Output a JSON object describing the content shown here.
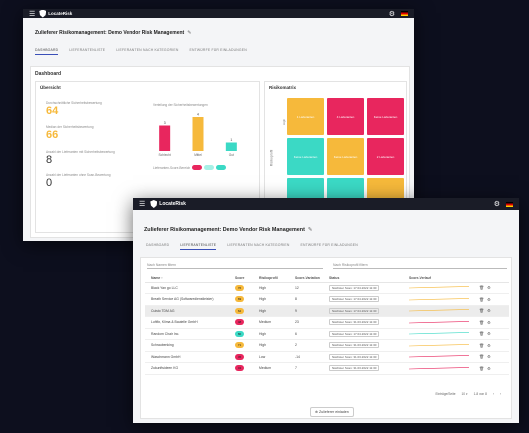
{
  "app": {
    "name": "LocateRisk",
    "title": "Zulieferer Risikomanagement: Demo Vendor Risk Management"
  },
  "tabs": [
    {
      "label": "DASHBOARD"
    },
    {
      "label": "LIEFERANTENLISTE"
    },
    {
      "label": "LIEFERANTEN NACH KATEGORIEN"
    },
    {
      "label": "ENTWÜRFE FÜR EINLADUNGEN"
    }
  ],
  "dashboard": {
    "heading": "Dashboard",
    "overview": {
      "heading": "Übersicht",
      "kpis": [
        {
          "label": "Durchschnittliche Sicherheitsbewertung",
          "value": "64",
          "color": "#f6b93b"
        },
        {
          "label": "Median der Sicherheitsbewertung",
          "value": "66",
          "color": "#f6b93b"
        },
        {
          "label": "Anzahl der Lieferanten mit Sicherheitsbewertung",
          "value": "8",
          "color": "#333333"
        },
        {
          "label": "Anzahl der Lieferanten ohne Scan-Bewertung",
          "value": "0",
          "color": "#333333"
        }
      ],
      "distribution_title": "Verteilung der Sicherheitsbewertungen",
      "legend_label": "Lieferanten-Score-Bereich"
    },
    "matrix": {
      "heading": "Risikomatrix",
      "y_axis": "Risikoprofil",
      "y_tick": "High",
      "cells": [
        {
          "label": "1 Lieferanten",
          "color": "#f6b93b"
        },
        {
          "label": "4 Lieferanten",
          "color": "#e8265e"
        },
        {
          "label": "Keine Lieferanten",
          "color": "#e8265e"
        },
        {
          "label": "Keine Lieferanten",
          "color": "#3bd9c5"
        },
        {
          "label": "Keine Lieferanten",
          "color": "#f6b93b"
        },
        {
          "label": "2 Lieferanten",
          "color": "#e8265e"
        },
        {
          "label": "",
          "color": "#3bd9c5"
        },
        {
          "label": "",
          "color": "#3bd9c5"
        },
        {
          "label": "",
          "color": "#f6b93b"
        }
      ]
    }
  },
  "chart_data": {
    "type": "bar",
    "title": "Verteilung der Sicherheitsbewertungen",
    "categories": [
      "Schlecht",
      "Mittel",
      "Gut"
    ],
    "values": [
      3,
      4,
      1
    ],
    "data_labels": [
      "3",
      "4",
      "1"
    ],
    "colors": [
      "#e8265e",
      "#f6b93b",
      "#3bd9c5"
    ],
    "ylim": [
      0,
      4
    ]
  },
  "list": {
    "filter_name": "Nach Namen filtern",
    "filter_profile": "Nach Risikoprofil filtern",
    "columns": [
      "Name ↑",
      "Score",
      "Risikoprofil",
      "Score-Variation",
      "Status",
      "Score-Verlauf"
    ],
    "rows": [
      {
        "name": "Black Yan go LLC",
        "score": "76",
        "score_color": "#f6b93b",
        "risk": "High",
        "variation": "12",
        "status": "Nächster Scan: 17.04.2022 11:30",
        "trend_color": "#f6b93b",
        "highlight": false
      },
      {
        "name": "Breath Service AG (Softwaredienstleister)",
        "score": "69",
        "score_color": "#f6b93b",
        "risk": "High",
        "variation": "8",
        "status": "Nächster Scan: 17.04.2022 11:30",
        "trend_color": "#f6b93b",
        "highlight": false
      },
      {
        "name": "Cuisto TDM AG",
        "score": "62",
        "score_color": "#f6b93b",
        "risk": "High",
        "variation": "9",
        "status": "Nächster Scan: 17.04.2022 11:30",
        "trend_color": "#f6b93b",
        "highlight": true
      },
      {
        "name": "Luftfix, Klima & Bautelle GmbH",
        "score": "48",
        "score_color": "#e8265e",
        "risk": "Medium",
        "variation": "23",
        "status": "Nächster Scan: 31.03.2022 11:30",
        "trend_color": "#e8265e",
        "highlight": false
      },
      {
        "name": "Random Chair Inc.",
        "score": "80",
        "score_color": "#3bd9c5",
        "risk": "High",
        "variation": "6",
        "status": "Nächster Scan: 17.04.2022 11:30",
        "trend_color": "#3bd9c5",
        "highlight": false
      },
      {
        "name": "Schraubenking",
        "score": "71",
        "score_color": "#f6b93b",
        "risk": "High",
        "variation": "2",
        "status": "Nächster Scan: 31.03.2022 11:30",
        "trend_color": "#f6b93b",
        "highlight": false
      },
      {
        "name": "Waschmann GmbH",
        "score": "45",
        "score_color": "#e8265e",
        "risk": "Low",
        "variation": "-14",
        "status": "Nächster Scan: 31.03.2022 11:30",
        "trend_color": "#e8265e",
        "highlight": false
      },
      {
        "name": "Zukunftsideen KG",
        "score": "43",
        "score_color": "#e8265e",
        "risk": "Medium",
        "variation": "7",
        "status": "Nächster Scan: 31.03.2022 11:30",
        "trend_color": "#e8265e",
        "highlight": false
      }
    ],
    "pagination": {
      "per_page_label": "Einträge/Seite",
      "per_page": "10",
      "range": "1-8 von 8"
    },
    "add_button": "Zulieferer einladen"
  }
}
